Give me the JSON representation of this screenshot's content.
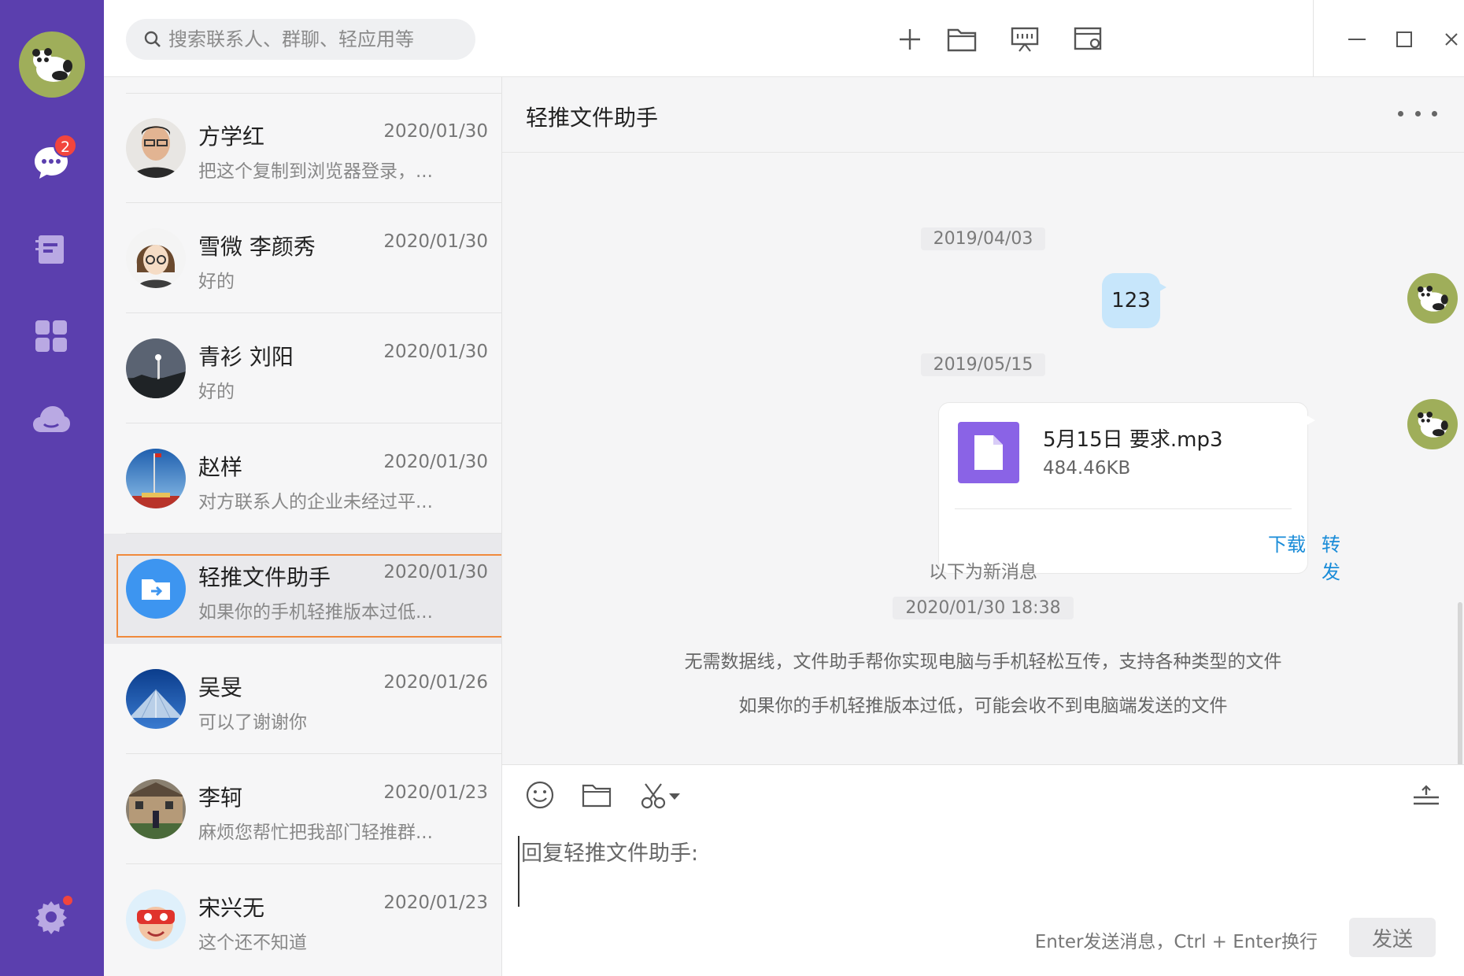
{
  "search": {
    "placeholder": "搜索联系人、群聊、轻应用等"
  },
  "rail": {
    "message_badge": "2"
  },
  "conversations": [
    {
      "name": "方学红",
      "date": "2020/01/30",
      "preview": "把这个复制到浏览器登录，..."
    },
    {
      "name": "雪微 李颜秀",
      "date": "2020/01/30",
      "preview": "好的"
    },
    {
      "name": "青衫 刘阳",
      "date": "2020/01/30",
      "preview": "好的"
    },
    {
      "name": "赵样",
      "date": "2020/01/30",
      "preview": "对方联系人的企业未经过平..."
    },
    {
      "name": "轻推文件助手",
      "date": "2020/01/30",
      "preview": "如果你的手机轻推版本过低..."
    },
    {
      "name": "吴旻",
      "date": "2020/01/26",
      "preview": "可以了谢谢你"
    },
    {
      "name": "李轲",
      "date": "2020/01/23",
      "preview": "麻烦您帮忙把我部门轻推群..."
    },
    {
      "name": "宋兴无",
      "date": "2020/01/23",
      "preview": "这个还不知道"
    }
  ],
  "chat": {
    "title": "轻推文件助手",
    "messages": {
      "ts1": "2019/04/03",
      "bubble1": "123",
      "ts2": "2019/05/15",
      "file": {
        "name": "5月15日 要求.mp3",
        "size": "484.46KB",
        "download": "下载",
        "forward": "转发"
      },
      "new_divider": "以下为新消息",
      "ts3": "2020/01/30 18:38",
      "sys1": "无需数据线，文件助手帮你实现电脑与手机轻松互传，支持各种类型的文件",
      "sys2": "如果你的手机轻推版本过低，可能会收不到电脑端发送的文件"
    }
  },
  "composer": {
    "placeholder": "回复轻推文件助手:",
    "hint": "Enter发送消息，Ctrl + Enter换行",
    "send_label": "发送"
  }
}
